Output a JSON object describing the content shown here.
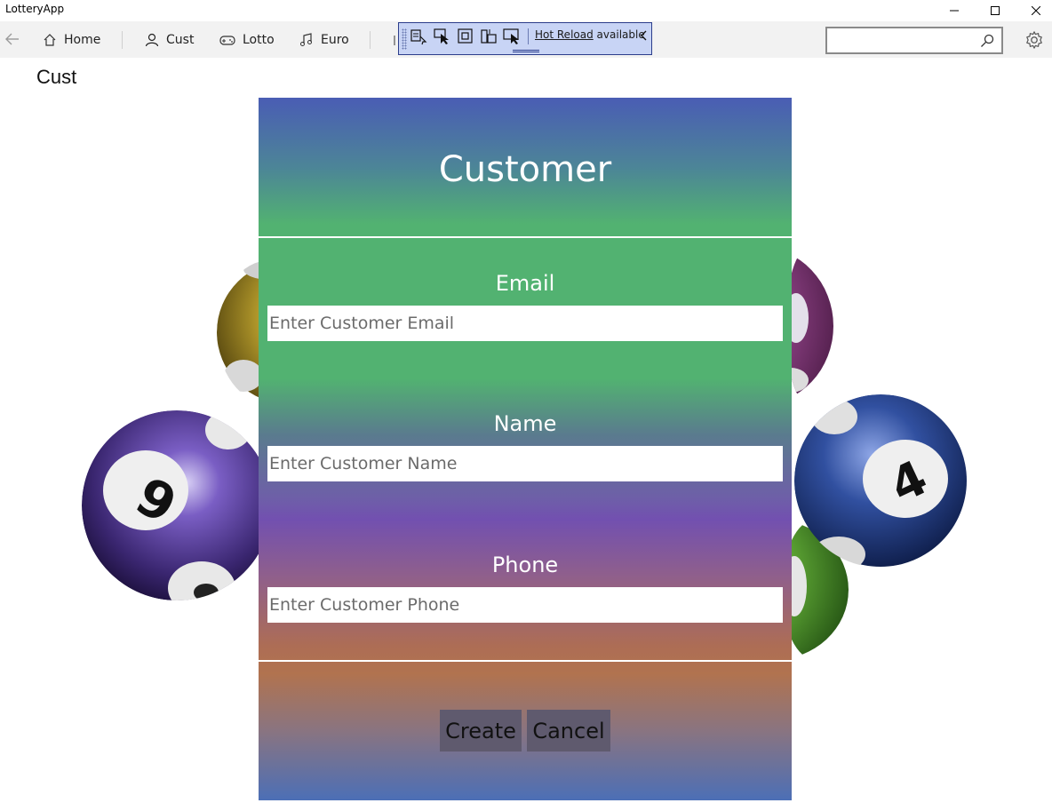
{
  "window": {
    "title": "LotteryApp"
  },
  "nav": {
    "items": [
      {
        "label": "Home",
        "icon": "home-icon"
      },
      {
        "label": "Cust",
        "icon": "person-icon",
        "selected": true
      },
      {
        "label": "Lotto",
        "icon": "gamepad-icon"
      },
      {
        "label": "Euro",
        "icon": "music-note-icon"
      }
    ],
    "search_placeholder": ""
  },
  "hot_reload": {
    "link": "Hot Reload",
    "status": "available"
  },
  "page": {
    "title": "Cust"
  },
  "form": {
    "title": "Customer",
    "fields": [
      {
        "label": "Email",
        "placeholder": "Enter Customer Email",
        "value": ""
      },
      {
        "label": "Name",
        "placeholder": "Enter Customer Name",
        "value": ""
      },
      {
        "label": "Phone",
        "placeholder": "Enter Customer Phone",
        "value": ""
      }
    ],
    "buttons": {
      "create": "Create",
      "cancel": "Cancel"
    }
  },
  "colors": {
    "accent": "#0067c0",
    "card_top": "#4a5db4",
    "card_green": "#52b271",
    "card_purple": "#7250b0",
    "card_orange": "#b1734f",
    "button_bg": "#5f5a6e"
  }
}
